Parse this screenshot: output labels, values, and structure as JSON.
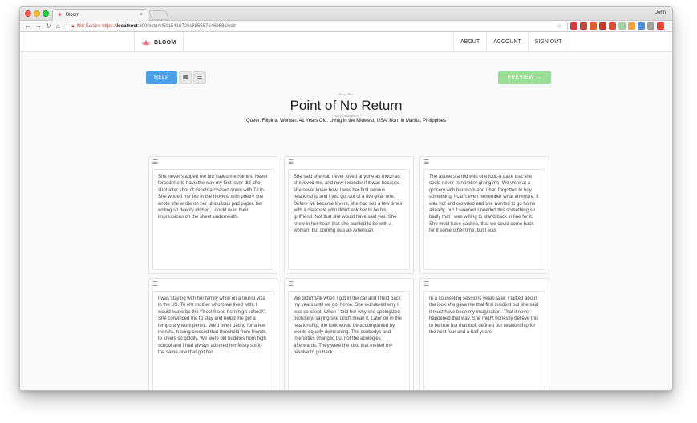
{
  "browser": {
    "tab_title": "Bloom",
    "profile_name": "John",
    "url_warning": "▲ Not Secure",
    "url_protocol": "https://",
    "url_host": "localhost",
    "url_path": ":3000/story/591541672ec886567646968c/edit",
    "extension_colors": [
      "#d9363e",
      "#c6453a",
      "#e05a2a",
      "#c53929",
      "#dd4b39",
      "#9fd3a5",
      "#f4a23c",
      "#4a8fd8",
      "#a0a0a0",
      "#ea4335"
    ]
  },
  "nav": {
    "brand": "BLOOM",
    "links": [
      "ABOUT",
      "ACCOUNT",
      "SIGN OUT"
    ]
  },
  "controls": {
    "help": "HELP",
    "preview": "PREVIEW →",
    "grid_icon": "grid-view-icon",
    "list_icon": "list-view-icon"
  },
  "story": {
    "title_label": "Story Title",
    "title": "Point of No Return",
    "description_label": "Story Description",
    "description": "Queer. Filipina. Woman. 41 Years Old. Living in the Midwest, USA. Born in Manila, Philippines"
  },
  "cards": [
    {
      "text": "She never slapped me nor called me names. Never forced me to have the way my first lover did after shot after shot of Ginebra chased down with 7-Up. She wooed me like in the movies, with poetry she wrote she wrote on her ubiquitous pad paper, her writing so deeply etched, I could read their impressions on the sheet underneath."
    },
    {
      "text": "She said she had never loved anyone as much as she loved me, and now I wonder if it was because she never knew how. I was her first serious relationship and I just got out of a five-year one. Before we became lovers, she had sex a few times with a clasmate who didn't ask her to be his girlfriend. Not that she would have said yes. She knew in her heart that she wanted to be with a woman, but coming was an American"
    },
    {
      "text": "The abuse started with one look-a gaze that she could never remember giving me. We were at a grocery with her mom and I had forgotten to buy something. I can't even remember what anymore. It was hot and crowded and she wanted to go home already, but it seemed I needed this something so badly that I was willing to stand back in line for it. She must have said no, that we could come back for it some other time, but I was"
    },
    {
      "text": "I was staying with her family while on a tourist visa in the US. To ehr mother whom we lived with, I would lways be the \\\"best friend from high school\\\". She convinced me to stay and helpd me get a temporary work permit. We'd been dating for a few months, having crossed that threshold from friends to lovers so giddily. We were old buddies from high school and I had always admired her feisty spirit-the same one that got her"
    },
    {
      "text": "We didn't talk when I got in the car and I held back my years until we got home. She wondered why I was so silent. When I told her why she apologized profusely, saying she dind't mean it. Later on in the relationship, the look would be accompanied by words-equally demeaning. The conbodys and intensities changed but not the apologies afterwards. They were the kind that melted my resolve to go back"
    },
    {
      "text": "In a counseling sessions years later, I talked about the look she gave me that first incident but she said it must have been my imagination. That it never happened that way. She might honestly believe this to be true but that look defined our relationship for the next four and a half years."
    }
  ]
}
